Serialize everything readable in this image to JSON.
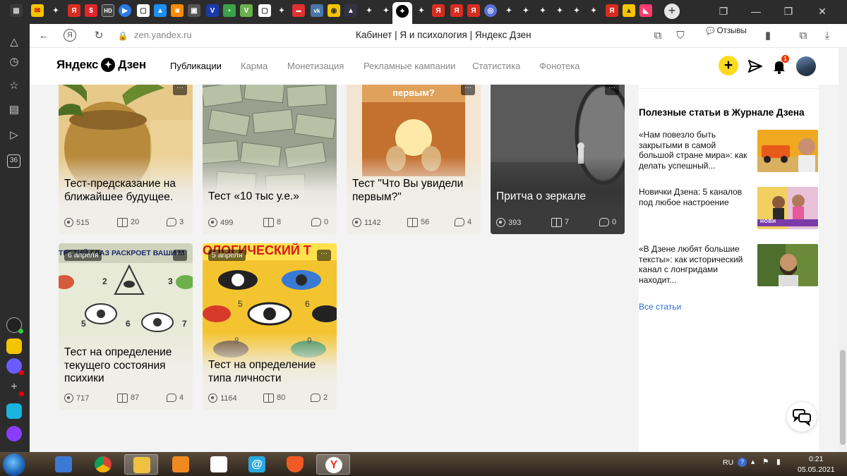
{
  "browser": {
    "url": "zen.yandex.ru",
    "title": "Кабинет | Я и психология | Яндекс Дзен",
    "reviews_label": "Отзывы",
    "sidebar_badge": "36"
  },
  "header": {
    "logo": "Яндекс",
    "logo_word": "Дзен",
    "nav": [
      "Публикации",
      "Карма",
      "Монетизация",
      "Рекламные кампании",
      "Статистика",
      "Фонотека"
    ],
    "notifications": "1"
  },
  "cards": [
    {
      "title": "Тест-предсказание на ближайшее будущее.",
      "views": "515",
      "reads": "20",
      "comments": "3",
      "date": "",
      "image": "plant-pot"
    },
    {
      "title": "Тест «10 тыс у.е.»",
      "views": "499",
      "reads": "8",
      "comments": "0",
      "date": "",
      "image": "money-stacks"
    },
    {
      "title": "Тест \"Что Вы увидели первым?\"",
      "views": "1142",
      "reads": "56",
      "comments": "4",
      "date": "",
      "image_text": "первым?",
      "image": "egg-sunrise"
    },
    {
      "title": "Притча о зеркале",
      "views": "393",
      "reads": "7",
      "comments": "0",
      "date": "",
      "image": "mirror"
    },
    {
      "title": "Тест на определение текущего состояния психики",
      "views": "717",
      "reads": "87",
      "comments": "4",
      "date": "6 апреля",
      "image_text": "ТРЕТИЙ ГЛАЗ РАСКРОЕТ ВАШИ М",
      "image": "eyes-drawing"
    },
    {
      "title": "Тест на определение типа личности",
      "views": "1164",
      "reads": "80",
      "comments": "2",
      "date": "5 апреля",
      "image_text": "ОЛОГИЧЕСКИЙ Т",
      "image": "eyes-yellow"
    }
  ],
  "more_label": "···",
  "right": {
    "title": "Полезные статьи в Журнале Дзена",
    "articles": [
      {
        "text": "«Нам повезло быть закрытыми в самой большой стране мира»: как делать успешный...",
        "thumb": "car-desert"
      },
      {
        "text": "Новички Дзена: 5 каналов под любое настроение",
        "thumb": "novichki",
        "thumb_text": "НОВИ"
      },
      {
        "text": "«В Дзене любят большие тексты»: как исторический канал с лонгридами находит...",
        "thumb": "bearded-man"
      }
    ],
    "all_link": "Все статьи"
  },
  "taskbar": {
    "lang": "RU",
    "time": "0:21",
    "date": "05.05.2021"
  }
}
